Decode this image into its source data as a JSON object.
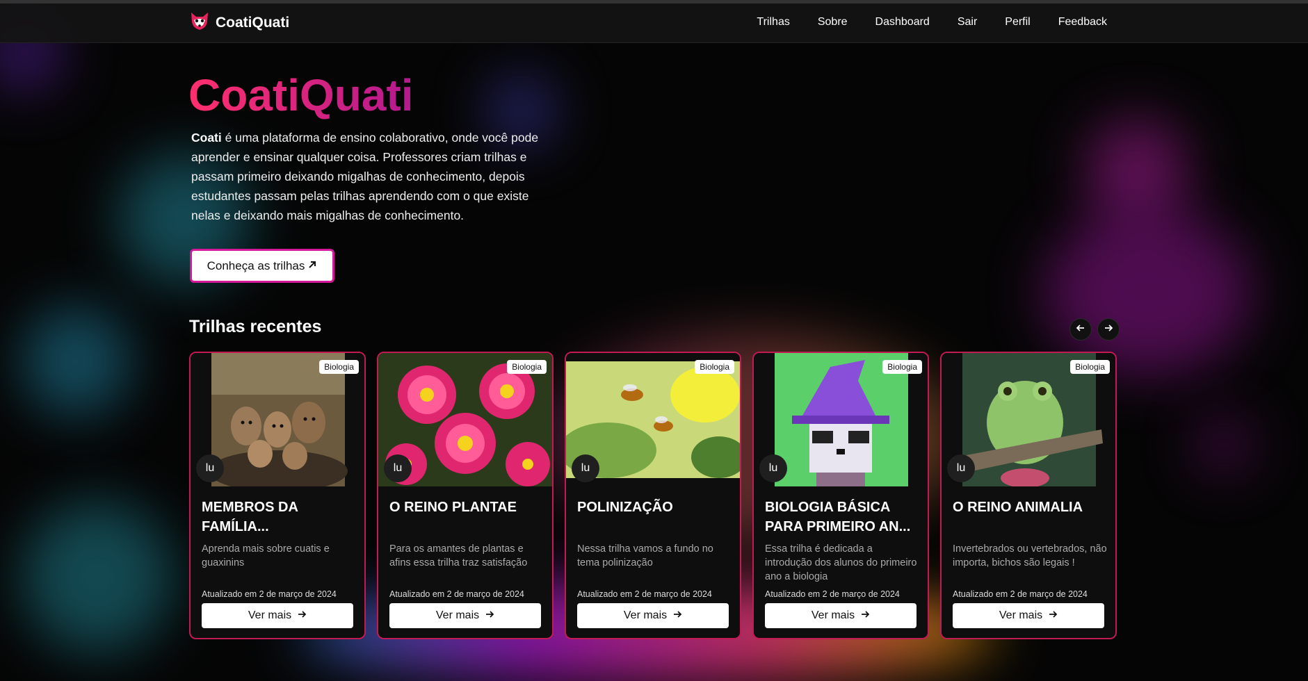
{
  "brand": {
    "name": "CoatiQuati",
    "accent": "#e91e63"
  },
  "nav": {
    "items": [
      "Trilhas",
      "Sobre",
      "Dashboard",
      "Sair",
      "Perfil",
      "Feedback"
    ]
  },
  "hero": {
    "title": "CoatiQuati",
    "desc_strong": "Coati",
    "desc_rest": " é uma plataforma de ensino colaborativo, onde você pode aprender e ensinar qualquer coisa. Professores criam trilhas e passam primeiro deixando migalhas de conhecimento, depois estudantes passam pelas trilhas aprendendo com o que existe nelas e deixando mais migalhas de conhecimento.",
    "cta_label": "Conheça as trilhas"
  },
  "recent": {
    "title": "Trilhas recentes",
    "cards": [
      {
        "title": "Membros da família...",
        "desc": "Aprenda mais sobre cuatis e guaxinins",
        "badge": "Biologia",
        "avatar": "lu",
        "updated": "Atualizado em 2 de março de 2024",
        "button": "Ver mais"
      },
      {
        "title": "O Reino Plantae",
        "desc": "Para os amantes de plantas e afins essa trilha traz satisfação",
        "badge": "Biologia",
        "avatar": "lu",
        "updated": "Atualizado em 2 de março de 2024",
        "button": "Ver mais"
      },
      {
        "title": "Polinização",
        "desc": "Nessa trilha vamos a fundo no tema polinização",
        "badge": "Biologia",
        "avatar": "lu",
        "updated": "Atualizado em 2 de março de 2024",
        "button": "Ver mais"
      },
      {
        "title": "Biologia básica para primeiro an...",
        "desc": "Essa trilha é dedicada a introdução dos alunos do primeiro ano a biologia",
        "badge": "Biologia",
        "avatar": "lu",
        "updated": "Atualizado em 2 de março de 2024",
        "button": "Ver mais"
      },
      {
        "title": "O Reino Animalia",
        "desc": "Invertebrados ou vertebrados, não importa, bichos são legais !",
        "badge": "Biologia",
        "avatar": "lu",
        "updated": "Atualizado em 2 de março de 2024",
        "button": "Ver mais"
      }
    ]
  }
}
